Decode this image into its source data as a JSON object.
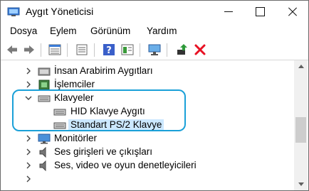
{
  "window": {
    "title": "Aygıt Yöneticisi",
    "app_icon": "device-manager-icon",
    "controls": [
      "minimize-icon",
      "maximize-icon",
      "close-icon"
    ]
  },
  "menubar": {
    "items": [
      {
        "label": "Dosya"
      },
      {
        "label": "Eylem"
      },
      {
        "label": "Görünüm"
      },
      {
        "label": "Yardım"
      }
    ]
  },
  "toolbar": {
    "buttons": [
      "back-arrow-icon",
      "forward-arrow-icon",
      "properties-grid-icon",
      "list-view-icon",
      "help-icon",
      "details-view-icon",
      "monitor-scan-icon",
      "update-driver-icon",
      "uninstall-x-icon"
    ]
  },
  "tree": {
    "items": [
      {
        "label": "İnsan Arabirim Aygıtları",
        "expanded": false,
        "level": 0,
        "icon": "hid-icon"
      },
      {
        "label": "İşlemciler",
        "expanded": false,
        "level": 0,
        "icon": "processor-icon"
      },
      {
        "label": "Klavyeler",
        "expanded": true,
        "level": 0,
        "icon": "keyboard-icon"
      },
      {
        "label": "HID Klavye Aygıtı",
        "level": 1,
        "icon": "keyboard-icon"
      },
      {
        "label": "Standart PS/2 Klavye",
        "level": 1,
        "icon": "keyboard-icon",
        "selected": true
      },
      {
        "label": "Monitörler",
        "expanded": false,
        "level": 0,
        "icon": "monitor-icon"
      },
      {
        "label": "Ses girişleri ve çıkışları",
        "expanded": false,
        "level": 0,
        "icon": "speaker-icon"
      },
      {
        "label": "Ses, video ve oyun denetleyicileri",
        "expanded": false,
        "level": 0,
        "icon": "speaker-icon"
      }
    ]
  },
  "colors": {
    "highlight_ring": "#1aa0d8",
    "selection": "#cce8ff",
    "uninstall_red": "#e81123",
    "update_green": "#2e9a3a"
  }
}
